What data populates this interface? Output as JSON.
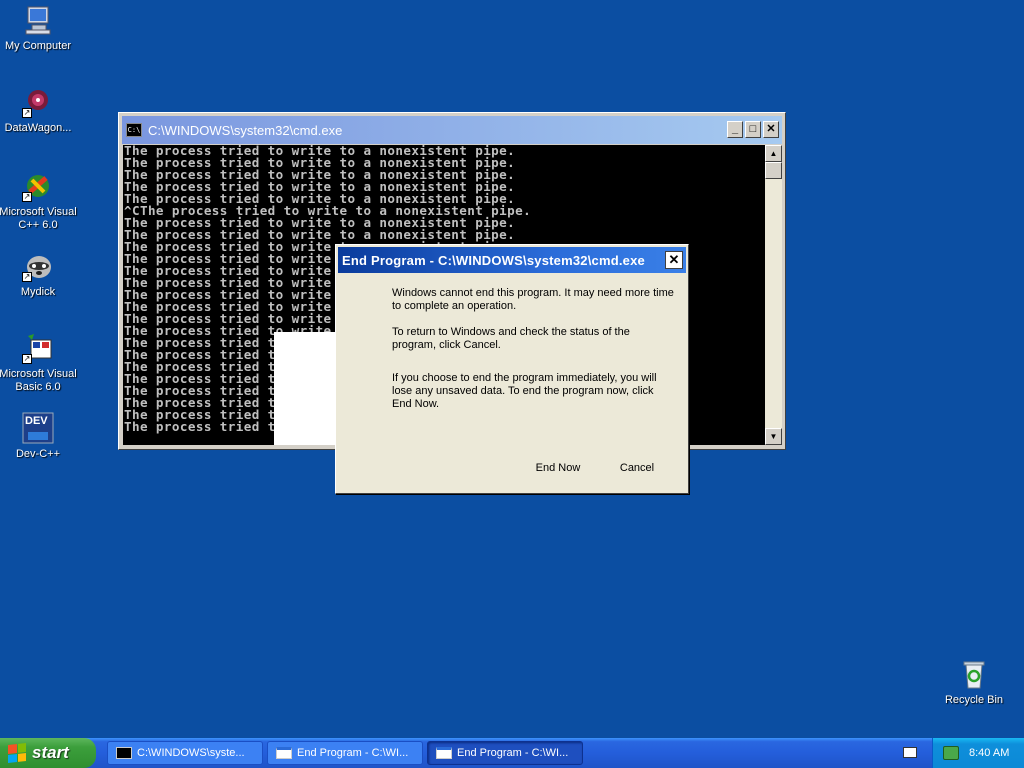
{
  "desktop": {
    "icons": [
      {
        "label": "My Computer"
      },
      {
        "label": "DataWagon..."
      },
      {
        "label": "Microsoft Visual C++ 6.0"
      },
      {
        "label": "Mydick"
      },
      {
        "label": "Microsoft Visual Basic 6.0"
      },
      {
        "label": "Dev-C++"
      },
      {
        "label": "Recycle Bin"
      }
    ],
    "dev_icon_text": "DEV"
  },
  "cmd_window": {
    "title": "C:\\WINDOWS\\system32\\cmd.exe",
    "icon_text": "C:\\",
    "lines": [
      "The process tried to write to a nonexistent pipe.",
      "The process tried to write to a nonexistent pipe.",
      "The process tried to write to a nonexistent pipe.",
      "The process tried to write to a nonexistent pipe.",
      "The process tried to write to a nonexistent pipe.",
      "^CThe process tried to write to a nonexistent pipe.",
      "The process tried to write to a nonexistent pipe.",
      "The process tried to write to a nonexistent pipe.",
      "The process tried to write to a nonexistent pipe.",
      "The process tried to write",
      "The process tried to write",
      "The process tried to write",
      "The process tried to write",
      "The process tried to write",
      "The process tried to write",
      "The process tried to write",
      "The process tried t",
      "The process tried t",
      "The process tried t",
      "The process tried t",
      "The process tried t",
      "The process tried t",
      "The process tried t",
      "The process tried t"
    ]
  },
  "dialog": {
    "title": "End Program - C:\\WINDOWS\\system32\\cmd.exe",
    "paragraph1": "Windows cannot end this program. It may need more time to complete an operation.",
    "paragraph2": "To return to Windows and check the status of the program, click Cancel.",
    "paragraph3": "If you choose to end the program immediately, you will lose any unsaved data. To end the program now, click End Now.",
    "end_now_label": "End Now",
    "cancel_label": "Cancel",
    "close_glyph": "✕"
  },
  "taskbar": {
    "start_label": "start",
    "tasks": [
      {
        "label": "C:\\WINDOWS\\syste...",
        "icon": "cmd-icon",
        "active": false
      },
      {
        "label": "End Program - C:\\WI...",
        "icon": "window-icon",
        "active": false
      },
      {
        "label": "End Program - C:\\WI...",
        "icon": "window-icon",
        "active": true
      }
    ],
    "clock": "8:40 AM"
  },
  "colors": {
    "desktop": "#0b4ea2",
    "console_bg": "#000000",
    "console_text": "#c0c0c0"
  }
}
